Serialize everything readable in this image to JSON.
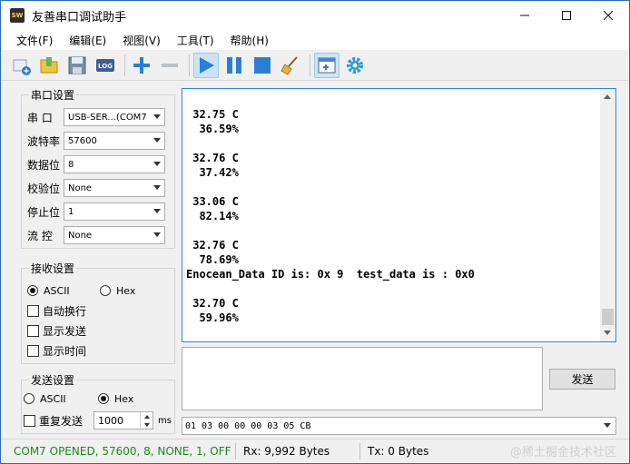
{
  "window": {
    "title": "友善串口调试助手",
    "app_icon_text": "SW"
  },
  "menu": [
    {
      "label": "文件(F)"
    },
    {
      "label": "编辑(E)"
    },
    {
      "label": "视图(V)"
    },
    {
      "label": "工具(T)"
    },
    {
      "label": "帮助(H)"
    }
  ],
  "toolbar": {
    "log_label": "LOG",
    "icons": [
      "new-session-icon",
      "open-folder-icon",
      "save-icon",
      "log-icon",
      "add-icon",
      "remove-icon",
      "play-icon",
      "pause-icon",
      "stop-icon",
      "clear-broom-icon",
      "window-add-icon",
      "gear-icon"
    ]
  },
  "serial_settings": {
    "title": "串口设置",
    "port": {
      "label": "串  口",
      "value": "USB-SER...(COM7"
    },
    "baud": {
      "label": "波特率",
      "value": "57600"
    },
    "data_bits": {
      "label": "数据位",
      "value": "8"
    },
    "parity": {
      "label": "校验位",
      "value": "None"
    },
    "stop_bits": {
      "label": "停止位",
      "value": "1"
    },
    "flow": {
      "label": "流  控",
      "value": "None"
    }
  },
  "receive_settings": {
    "title": "接收设置",
    "ascii": "ASCII",
    "hex": "Hex",
    "selected": "ascii",
    "auto_newline": "自动换行",
    "show_send": "显示发送",
    "show_time": "显示时间"
  },
  "send_settings": {
    "title": "发送设置",
    "ascii": "ASCII",
    "hex": "Hex",
    "selected": "hex",
    "repeat_label": "重复发送",
    "interval": "1000",
    "unit": "ms"
  },
  "receive_text": "\n 32.75 C\n  36.59%\n\n 32.76 C\n  37.42%\n\n 33.06 C\n  82.14%\n\n 32.76 C\n  78.69%\nEnocean_Data ID is: 0x 9  test_data is : 0x0\n\n 32.70 C\n  59.96%",
  "send": {
    "button": "发送",
    "hex_data": "01 03 00 00 00 03 05 CB"
  },
  "status": {
    "connection": "COM7 OPENED, 57600, 8, NONE, 1, OFF",
    "rx": "Rx: 9,992 Bytes",
    "tx": "Tx: 0 Bytes",
    "watermark": "@稀土掘金技术社区"
  },
  "colors": {
    "accent": "#2c88d9",
    "status_ok": "#1a8a1a"
  }
}
